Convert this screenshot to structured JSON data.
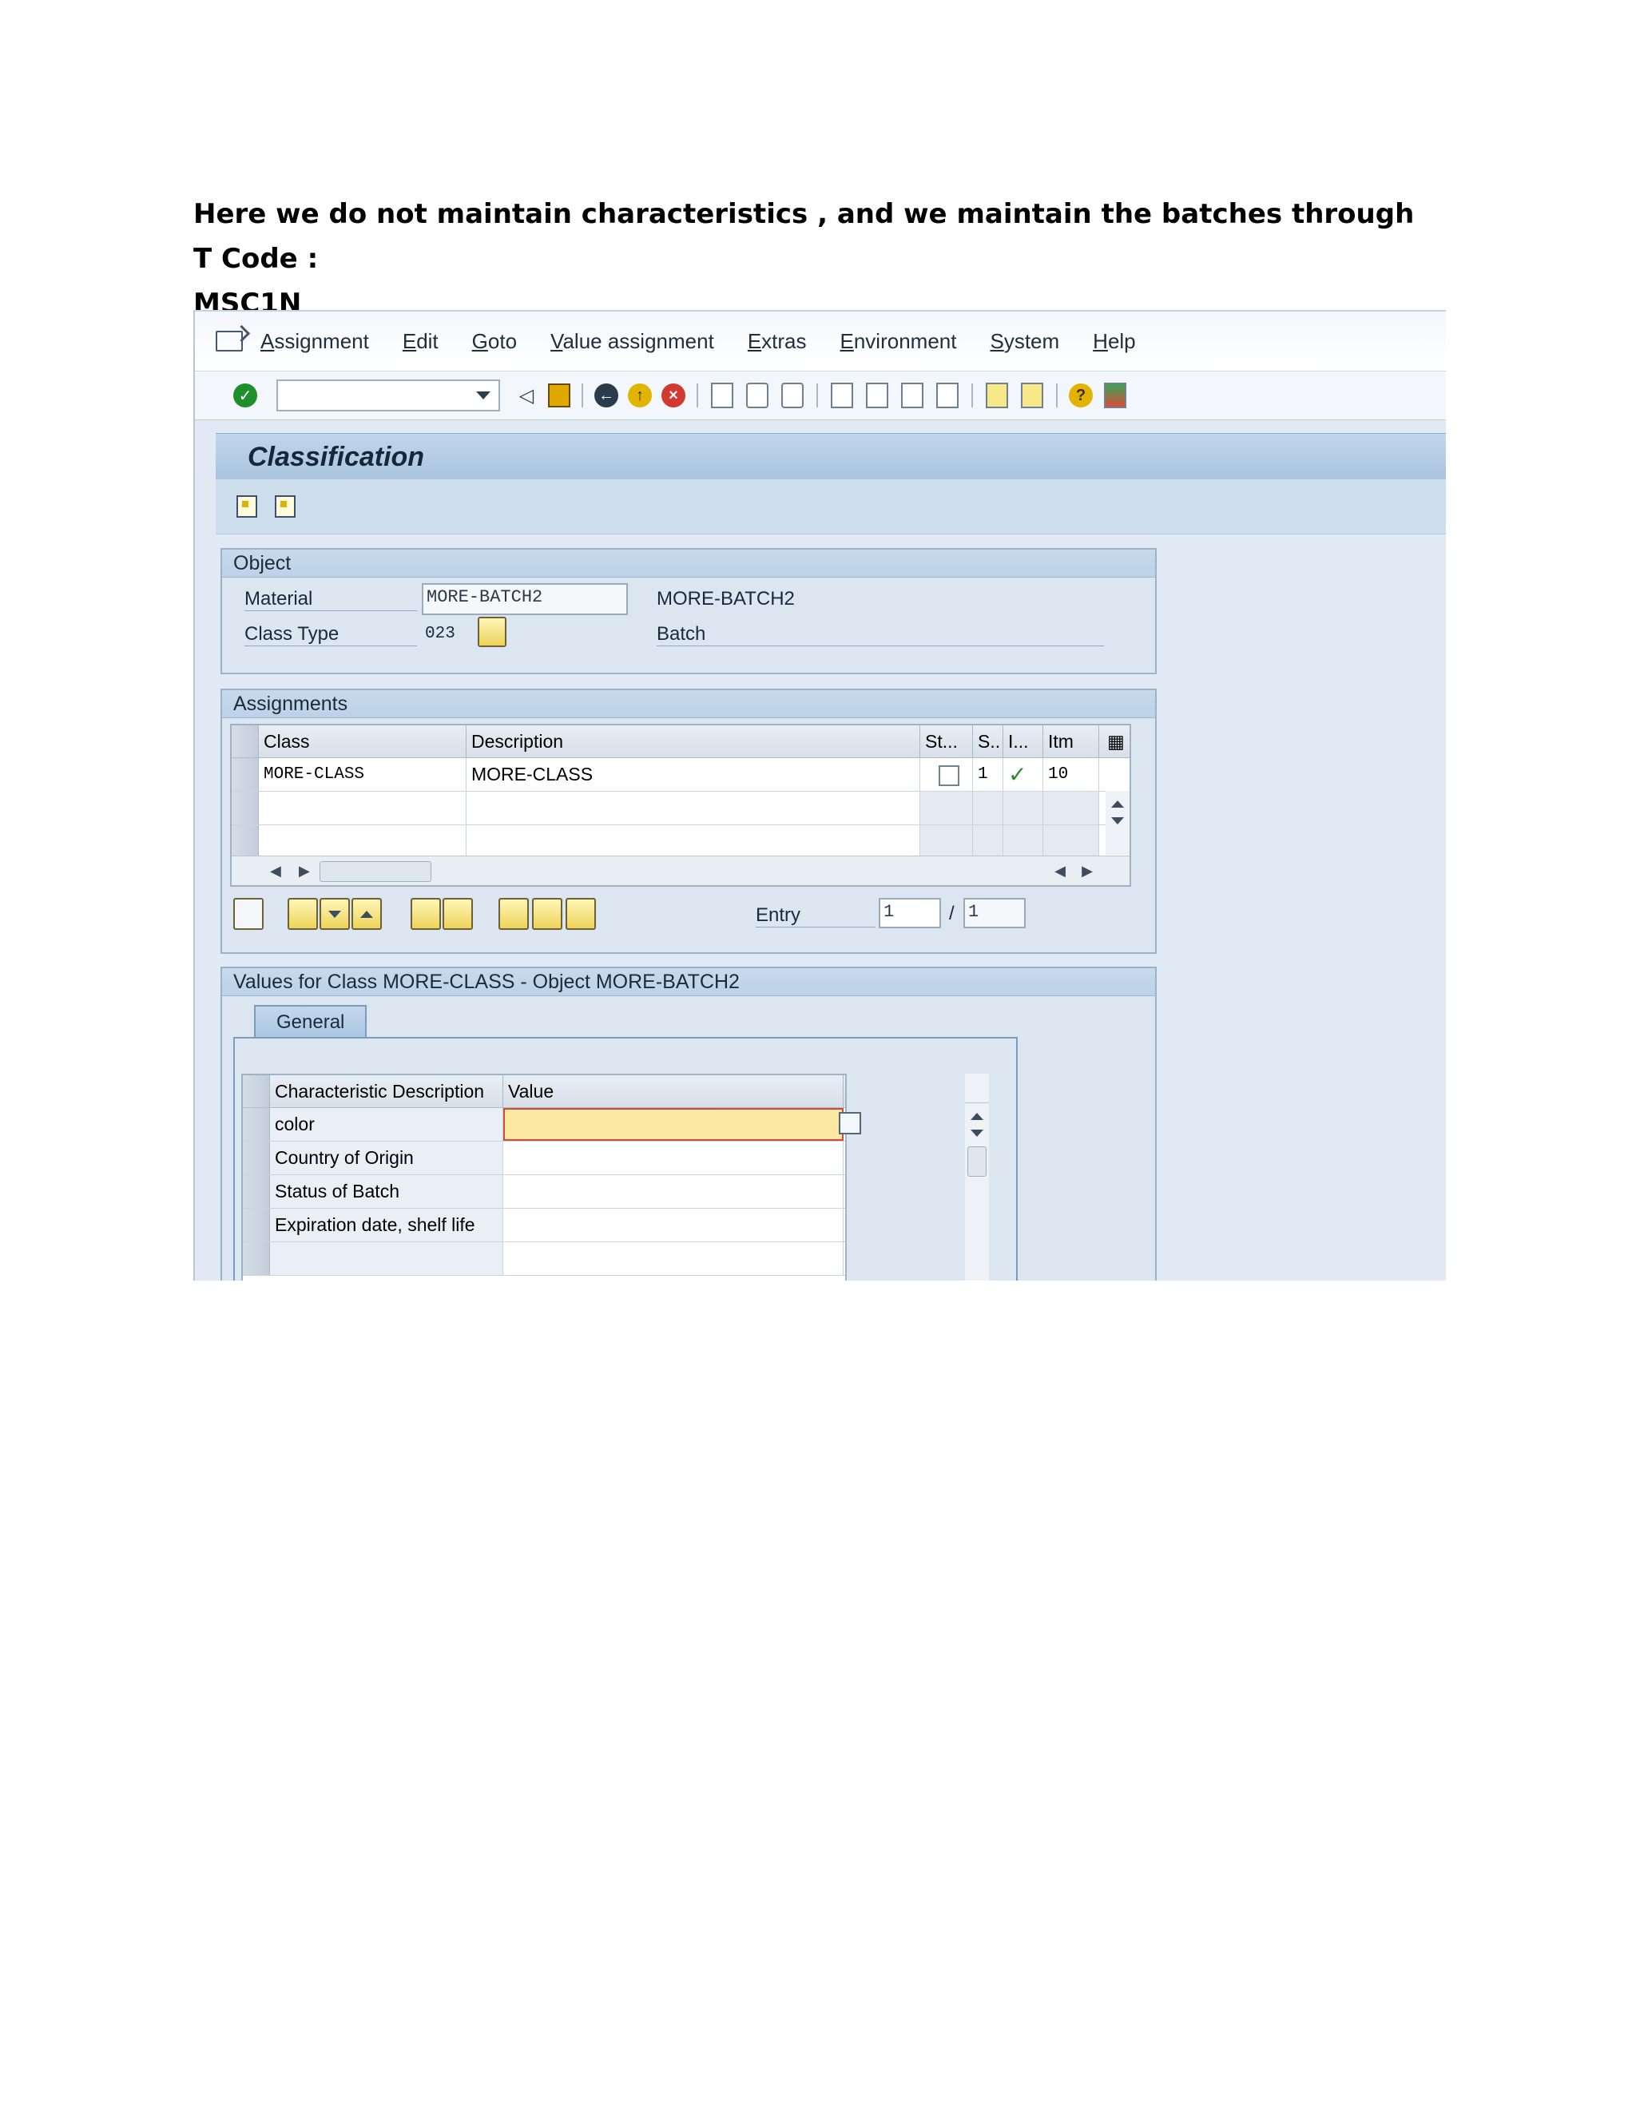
{
  "document": {
    "line1": "Here we do not maintain characteristics , and we maintain the batches through T Code :",
    "line2": "MSC1N"
  },
  "menu": [
    "Assignment",
    "Edit",
    "Goto",
    "Value assignment",
    "Extras",
    "Environment",
    "System",
    "Help"
  ],
  "screen_title": "Classification",
  "object": {
    "group_title": "Object",
    "material_label": "Material",
    "material_value": "MORE-BATCH2",
    "material_desc": "MORE-BATCH2",
    "class_type_label": "Class Type",
    "class_type_value": "023",
    "class_type_desc": "Batch"
  },
  "assignments": {
    "group_title": "Assignments",
    "columns": [
      "Class",
      "Description",
      "St...",
      "S..",
      "I...",
      "Itm"
    ],
    "rows": [
      {
        "class": "MORE-CLASS",
        "description": "MORE-CLASS",
        "status": "1",
        "item": "10"
      }
    ],
    "entry_label": "Entry",
    "entry_value": "1",
    "entry_sep": "/",
    "entry_total": "1"
  },
  "values": {
    "group_title": "Values for Class MORE-CLASS - Object MORE-BATCH2",
    "tab": "General",
    "columns": [
      "Characteristic Description",
      "Value"
    ],
    "rows": [
      "color",
      "Country of Origin",
      "Status of Batch",
      "Expiration date, shelf life"
    ]
  },
  "colors": {
    "accent_title": "#a9c4df",
    "highlight_field": "#fbe9a2",
    "check_green": "#2d8a2d"
  }
}
